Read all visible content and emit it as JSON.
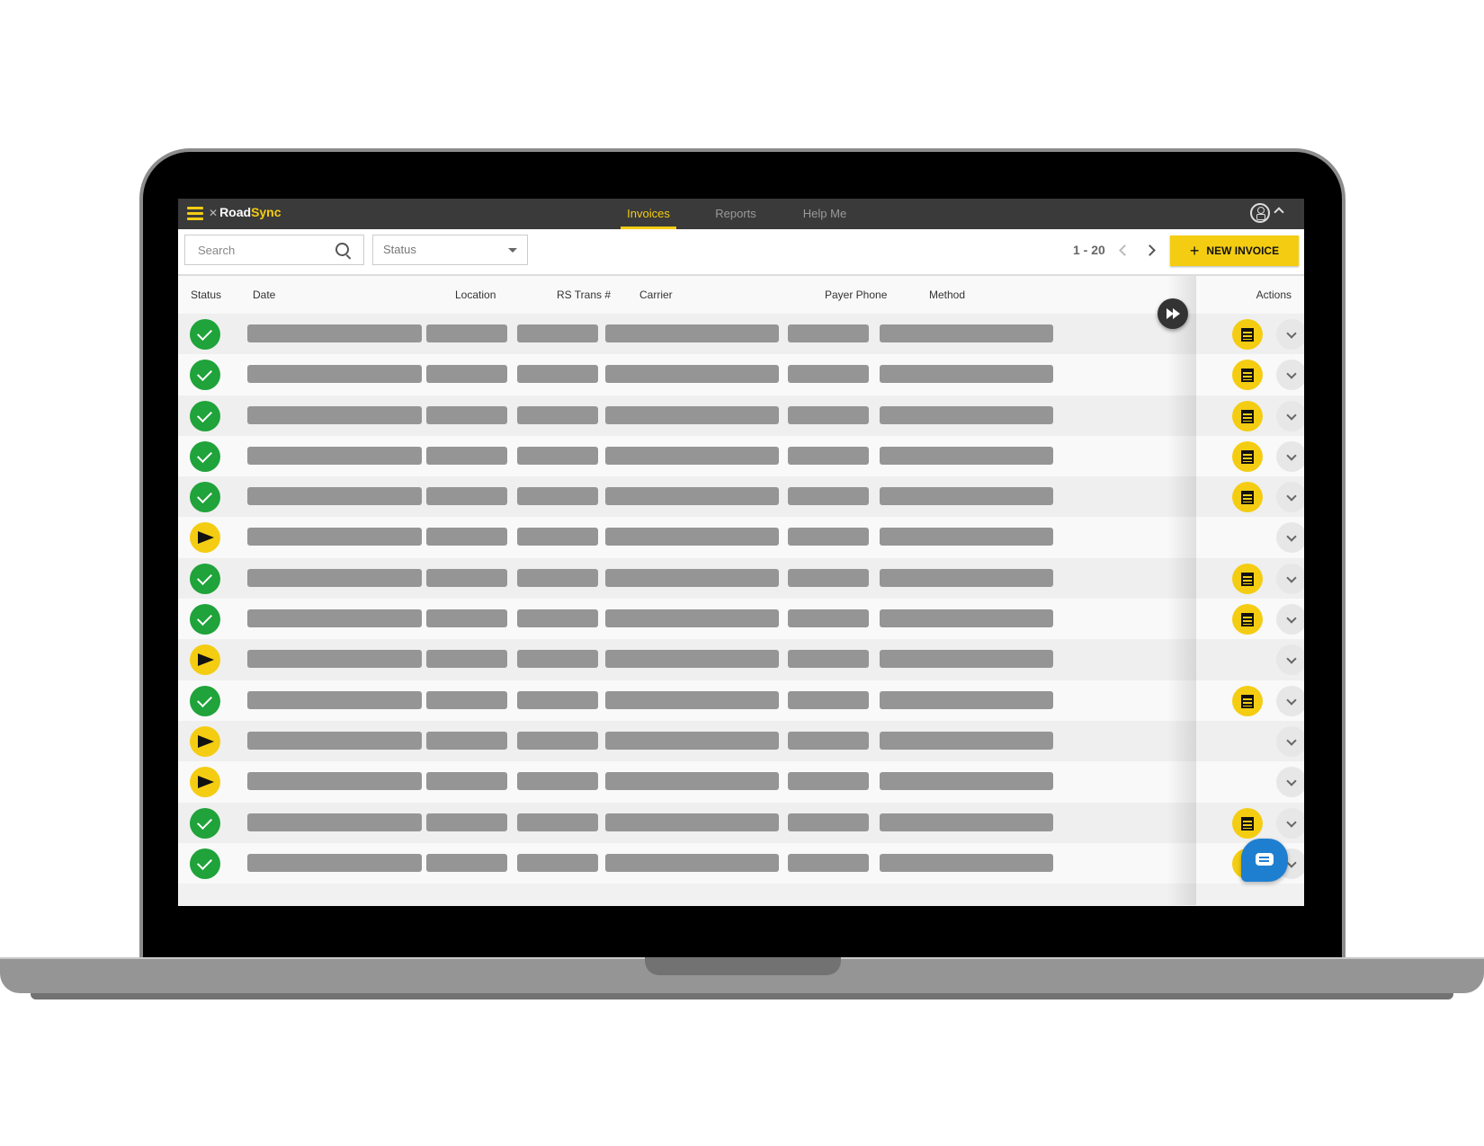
{
  "app": {
    "brand_prefix": "Road",
    "brand_suffix": "Sync"
  },
  "nav": {
    "tabs": [
      {
        "label": "Invoices",
        "active": true
      },
      {
        "label": "Reports",
        "active": false
      },
      {
        "label": "Help Me",
        "active": false
      }
    ]
  },
  "toolbar": {
    "search_placeholder": "Search",
    "status_placeholder": "Status",
    "range": "1 - 20",
    "new_invoice_label": "NEW INVOICE"
  },
  "table": {
    "columns": [
      "Status",
      "Date",
      "Location",
      "RS Trans #",
      "Carrier",
      "Payer Phone",
      "Method"
    ],
    "actions_label": "Actions",
    "rows": [
      {
        "status": "paid",
        "has_receipt": true
      },
      {
        "status": "paid",
        "has_receipt": true
      },
      {
        "status": "paid",
        "has_receipt": true
      },
      {
        "status": "paid",
        "has_receipt": true
      },
      {
        "status": "paid",
        "has_receipt": true
      },
      {
        "status": "sent",
        "has_receipt": false
      },
      {
        "status": "paid",
        "has_receipt": true
      },
      {
        "status": "paid",
        "has_receipt": true
      },
      {
        "status": "sent",
        "has_receipt": false
      },
      {
        "status": "paid",
        "has_receipt": true
      },
      {
        "status": "sent",
        "has_receipt": false
      },
      {
        "status": "sent",
        "has_receipt": false
      },
      {
        "status": "paid",
        "has_receipt": true
      },
      {
        "status": "paid",
        "has_receipt": true
      }
    ]
  },
  "icons": {
    "menu": "hamburger-icon",
    "search": "search-icon",
    "user": "user-icon",
    "paid": "check-circle-icon",
    "sent": "send-icon",
    "receipt": "receipt-icon",
    "expand": "chevron-down-icon",
    "scroll": "fast-forward-icon",
    "chat": "chat-icon"
  },
  "colors": {
    "brand_yellow": "#f4cd12",
    "paid_green": "#1fa33a",
    "topbar": "#3a3a3a",
    "chat_blue": "#1e7fd0"
  }
}
